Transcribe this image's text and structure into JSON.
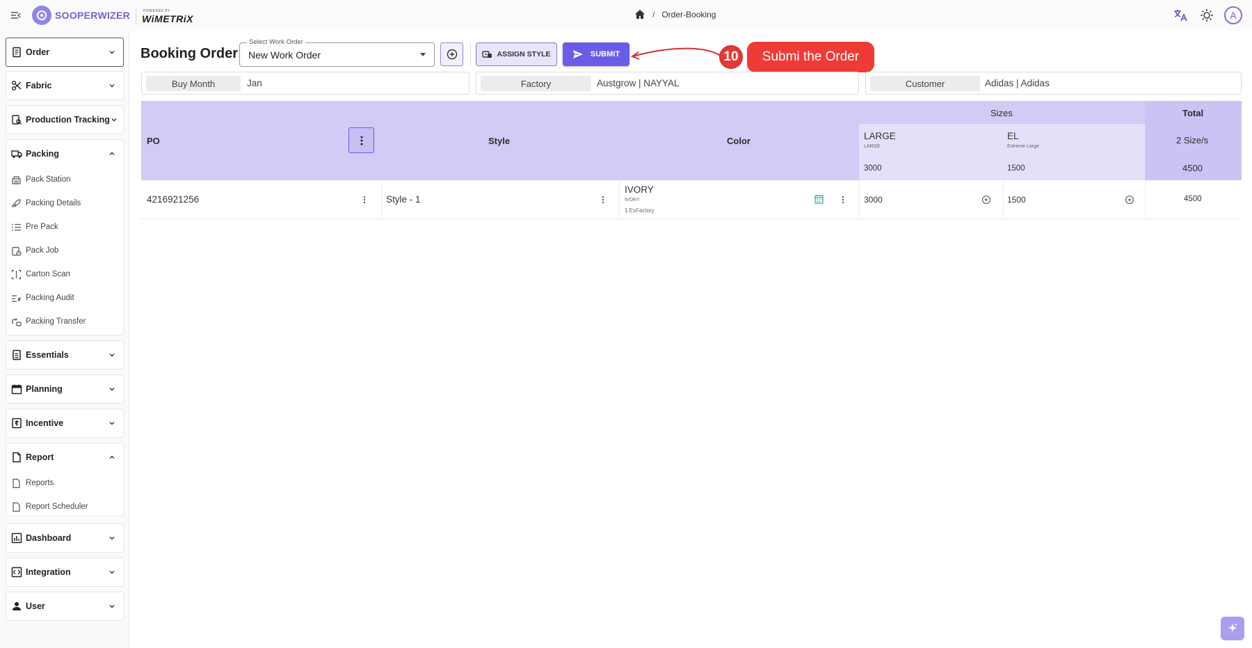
{
  "brand": {
    "name": "SOOPERWIZER",
    "powered_small": "POWERED BY",
    "powered_name": "WiMETRiX"
  },
  "breadcrumb": {
    "separator": "/",
    "current": "Order-Booking"
  },
  "sidebar": {
    "groups": [
      {
        "label": "Order",
        "icon": "receipt-icon",
        "state": "collapsed"
      },
      {
        "label": "Fabric",
        "icon": "scissors-icon",
        "state": "collapsed"
      },
      {
        "label": "Production Tracking",
        "icon": "tracking-icon",
        "state": "collapsed"
      },
      {
        "label": "Packing",
        "icon": "truck-icon",
        "state": "expanded",
        "items": [
          "Pack Station",
          "Packing Details",
          "Pre Pack",
          "Pack Job",
          "Carton Scan",
          "Packing Audit",
          "Packing Transfer"
        ]
      },
      {
        "label": "Essentials",
        "icon": "document-icon",
        "state": "collapsed"
      },
      {
        "label": "Planning",
        "icon": "calendar-icon",
        "state": "collapsed"
      },
      {
        "label": "Incentive",
        "icon": "incentive-icon",
        "state": "collapsed"
      },
      {
        "label": "Report",
        "icon": "report-icon",
        "state": "expanded",
        "items": [
          "Reports",
          "Report Scheduler"
        ]
      },
      {
        "label": "Dashboard",
        "icon": "dashboard-icon",
        "state": "collapsed"
      },
      {
        "label": "Integration",
        "icon": "integration-icon",
        "state": "collapsed"
      },
      {
        "label": "User",
        "icon": "user-icon",
        "state": "collapsed"
      }
    ]
  },
  "main": {
    "title": "Booking Order",
    "work_order": {
      "label": "Select Work Order",
      "value": "New Work Order"
    },
    "assign_style_label": "ASSIGN STYLE",
    "submit_label": "SUBMIT",
    "annotation": {
      "step": "10",
      "text": "Submi the Order"
    },
    "info": {
      "buy_month_label": "Buy Month",
      "buy_month_value": "Jan",
      "factory_label": "Factory",
      "factory_value": "Austgrow | NAYYAL",
      "customer_label": "Customer",
      "customer_value": "Adidas | Adidas"
    },
    "grid": {
      "headers": {
        "po": "PO",
        "style": "Style",
        "color": "Color",
        "sizes": "Sizes",
        "total": "Total"
      },
      "sizes": [
        {
          "name": "LARGE",
          "desc": "LARGE",
          "total": "3000"
        },
        {
          "name": "EL",
          "desc": "Extreme Large",
          "total": "1500"
        }
      ],
      "size_count": "2 Size/s",
      "grand_total": "4500",
      "rows": [
        {
          "po": "4216921256",
          "style": "Style - 1",
          "color": "IVORY",
          "color_sub": "IVORY",
          "color_note": "1 ExFactory",
          "qty": [
            "3000",
            "1500"
          ],
          "total": "4500"
        }
      ]
    }
  },
  "colors": {
    "accent": "#6b5ce7",
    "header_bg": "#d1cbf5",
    "callout": "#ef3b36"
  }
}
